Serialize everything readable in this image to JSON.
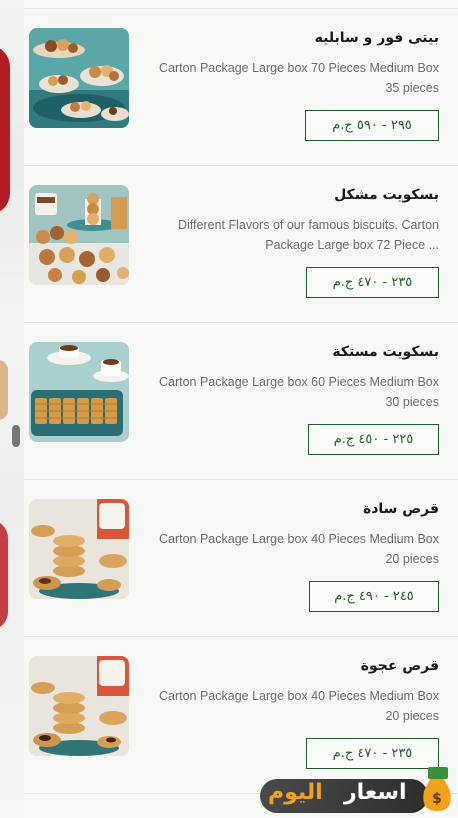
{
  "items": [
    {
      "name": "بيتى فور و سابليه",
      "description": "Carton Package Large box 70 Pieces Medium Box 35 pieces",
      "price": "٢٩٥ - ٥٩٠ ج.م",
      "image_icon": "petit-four-plate-photo"
    },
    {
      "name": "بسكويت مشكل",
      "description": "Different Flavors of our famous biscuits. Carton Package Large box 72 Piece ...",
      "price": "٢٣٥ - ٤٧٠ ج.م",
      "image_icon": "mixed-biscuits-photo"
    },
    {
      "name": "بسكويت مستكة",
      "description": "Carton Package Large box 60 Pieces Medium Box 30 pieces",
      "price": "٢٢٥ - ٤٥٠ ج.م",
      "image_icon": "mastic-biscuits-tray-photo"
    },
    {
      "name": "قرص سادة",
      "description": "Carton Package Large box 40 Pieces Medium Box 20 pieces",
      "price": "٢٤٥ - ٤٩٠ ج.م",
      "image_icon": "plain-qors-stack-photo"
    },
    {
      "name": "قرص عجوة",
      "description": "Carton Package Large box 40 Pieces Medium Box 20 pieces",
      "price": "٢٣٥ - ٤٧٠ ج.م",
      "image_icon": "date-qors-stack-photo"
    }
  ],
  "watermark": {
    "word_prices": "اسعار",
    "word_today": "اليوم"
  },
  "colors": {
    "price_border": "#1e5a2c",
    "list_background": "#f7f7f6",
    "watermark_orange": "#f2a21a"
  }
}
